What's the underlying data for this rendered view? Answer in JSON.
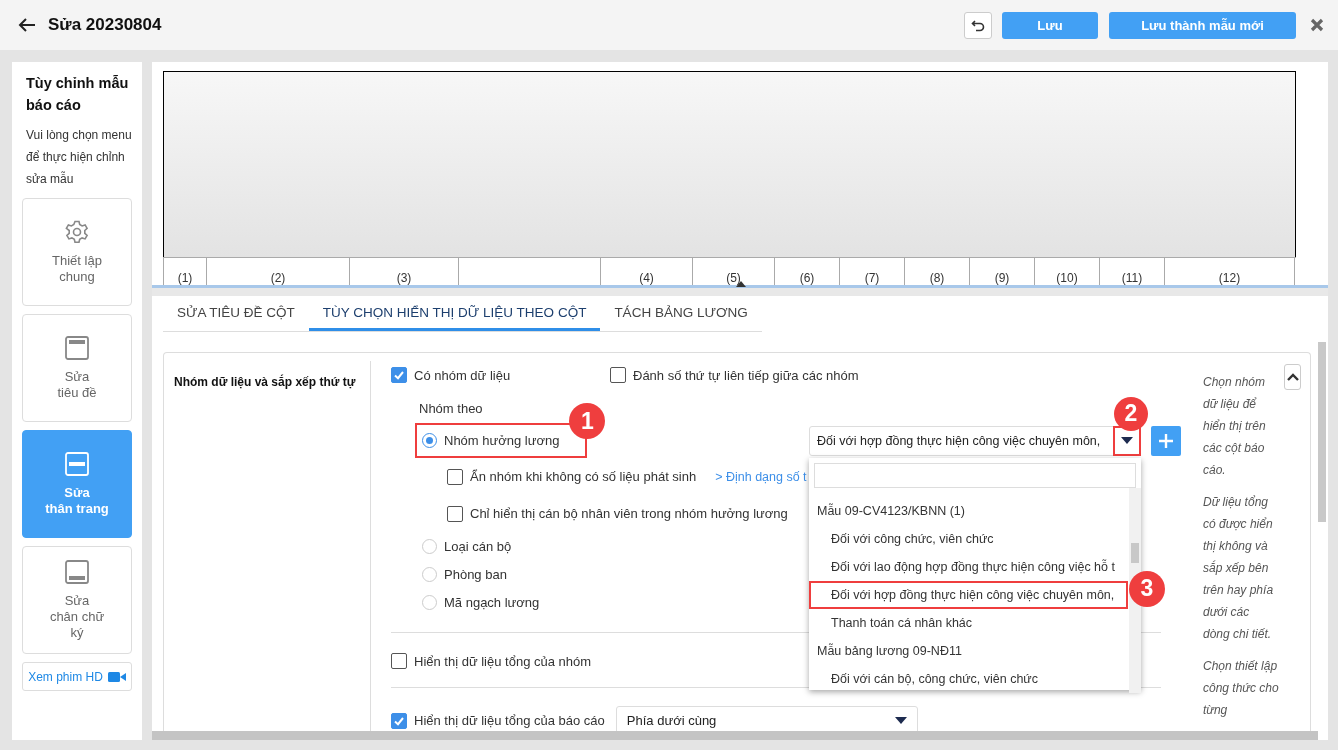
{
  "header": {
    "title": "Sửa 20230804",
    "actions": [
      {
        "kind": "undo"
      },
      {
        "kind": "save",
        "label": "Lưu"
      },
      {
        "kind": "save_as",
        "label": "Lưu thành mẫu mới"
      },
      {
        "kind": "close"
      }
    ]
  },
  "sidebar": {
    "title": "Tùy chỉnh mẫu báo cáo",
    "description": "Vui lòng chọn menu để thực hiện chỉnh sửa mẫu",
    "items": [
      {
        "kind": "general",
        "label": "Thiết lập\nchung",
        "selected": false
      },
      {
        "kind": "header",
        "label": "Sửa\ntiêu đề",
        "selected": false
      },
      {
        "kind": "body",
        "label": "Sửa\nthân trang",
        "selected": true
      },
      {
        "kind": "footer",
        "label": "Sửa\nchân chữ\nký",
        "selected": false
      }
    ],
    "video_link": "Xem phim HD"
  },
  "preview": {
    "columns": [
      {
        "kind": "numbered",
        "label": "(1)"
      },
      {
        "kind": "numbered",
        "label": "(2)"
      },
      {
        "kind": "numbered",
        "label": "(3)"
      },
      {
        "kind": "blank"
      },
      {
        "kind": "numbered",
        "label": "(4)"
      },
      {
        "kind": "numbered",
        "label": "(5)"
      },
      {
        "kind": "numbered",
        "label": "(6)"
      },
      {
        "kind": "numbered",
        "label": "(7)"
      },
      {
        "kind": "numbered",
        "label": "(8)"
      },
      {
        "kind": "numbered",
        "label": "(9)"
      },
      {
        "kind": "numbered",
        "label": "(10)"
      },
      {
        "kind": "numbered",
        "label": "(11)"
      },
      {
        "kind": "numbered",
        "label": "(12)"
      }
    ]
  },
  "tabs": [
    {
      "label": "SỬA TIÊU ĐỀ CỘT",
      "selected": false
    },
    {
      "label": "TÙY CHỌN HIỂN THỊ DỮ LIỆU THEO CỘT",
      "selected": true
    },
    {
      "label": "TÁCH BẢNG LƯƠNG",
      "selected": false
    }
  ],
  "grouping": {
    "label": "Nhóm dữ liệu và sắp xếp thứ tự",
    "options": [
      {
        "label": "Có nhóm dữ liệu",
        "checked": true
      },
      {
        "label": "Đánh số thứ tự liên tiếp giữa các nhóm",
        "checked": false
      }
    ],
    "group_by_label": "Nhóm theo",
    "group_by": [
      {
        "label": "Nhóm hưởng lương",
        "selected": true,
        "callout": "1",
        "sub_options": [
          {
            "label": "Ẩn nhóm khi không có số liệu phát sinh",
            "checked": false,
            "link": "> Định dạng số t"
          },
          {
            "label": "Chỉ hiển thị cán bộ nhân viên trong nhóm hưởng lương",
            "checked": false
          }
        ],
        "select": {
          "value": "Đối với hợp đồng thực hiện công việc chuyên môn,",
          "arrow_callout": "2",
          "expanded": true,
          "options": [
            {
              "label": "Mẫu 09-CV4123/KBNN (1)",
              "children": [
                {
                  "label": "Đối với công chức, viên chức"
                },
                {
                  "label": "Đối với lao động hợp đồng thực hiện công việc hỗ t"
                },
                {
                  "label": "Đối với hợp đồng thực hiện công việc chuyên môn,",
                  "callout": "3"
                },
                {
                  "label": "Thanh toán cá nhân khác"
                }
              ]
            },
            {
              "label": "Mẫu bảng lương 09-NĐ11",
              "children": [
                {
                  "label": "Đối với cán bộ, công chức, viên chức"
                }
              ]
            }
          ]
        }
      },
      {
        "label": "Loại cán bộ",
        "selected": false
      },
      {
        "label": "Phòng ban",
        "selected": false
      },
      {
        "label": "Mã ngạch lương",
        "selected": false
      }
    ],
    "group_total": {
      "label": "Hiển thị dữ liệu tổng của nhóm",
      "checked": false
    },
    "report_total": {
      "label": "Hiển thị dữ liệu tổng của báo cáo",
      "checked": true,
      "value": "Phía dưới cùng"
    }
  },
  "hints": [
    "Chọn nhóm dữ liệu để hiển thị trên các cột báo cáo.",
    "Dữ liệu tổng có được hiển thị không và sắp xếp bên trên hay phía dưới các dòng chi tiết.",
    "Chọn thiết lập công thức cho từng"
  ]
}
